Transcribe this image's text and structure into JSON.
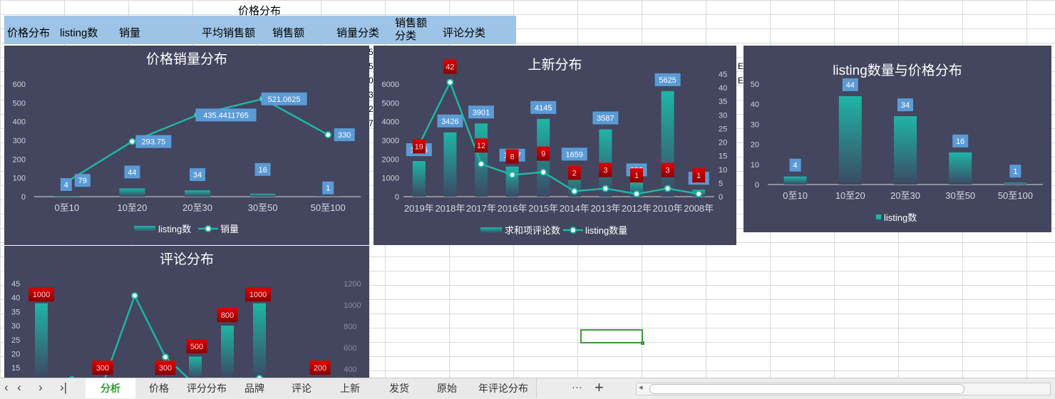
{
  "sheet": {
    "title": "价格分布",
    "headers": [
      "价格分布",
      "listing数",
      "销量",
      "平均销售额",
      "销售额",
      "销量分类",
      "销售额\n分类",
      "评论分类"
    ]
  },
  "charts": {
    "price_sales": {
      "title": "价格销量分布",
      "chart_data": {
        "type": "bar+line",
        "categories": [
          "0至10",
          "10至20",
          "20至30",
          "30至50",
          "50至100"
        ],
        "series": [
          {
            "name": "listing数",
            "type": "bar",
            "values": [
              4,
              44,
              34,
              16,
              1
            ]
          },
          {
            "name": "销量",
            "type": "line",
            "values": [
              79,
              293.75,
              435.4411765,
              521.0625,
              330
            ]
          }
        ],
        "y_ticks": [
          "0",
          "100",
          "200",
          "300",
          "400",
          "500",
          "600"
        ],
        "ylim": [
          0,
          600
        ],
        "bar_scale_max": 600,
        "line_labels": [
          "79",
          "293.75",
          "435.4411765",
          "521.0625",
          "330"
        ],
        "bar_labels": [
          "4",
          "44",
          "34",
          "16",
          "1"
        ]
      }
    },
    "new_listing": {
      "title": "上新分布",
      "chart_data": {
        "type": "bar+line",
        "categories": [
          "2019年",
          "2018年",
          "2017年",
          "2016年",
          "2015年",
          "2014年",
          "2013年",
          "2012年",
          "2010年",
          "2008年"
        ],
        "series": [
          {
            "name": "求和项评论数",
            "type": "bar",
            "values": [
              1895,
              3426,
              3901,
              1607,
              4145,
              1659,
              3587,
              823,
              5625,
              372
            ]
          },
          {
            "name": "listing数量",
            "type": "line",
            "values": [
              19,
              42,
              12,
              8,
              9,
              2,
              3,
              1,
              3,
              1
            ]
          }
        ],
        "y_ticks": [
          "0",
          "1000",
          "2000",
          "3000",
          "4000",
          "5000",
          "6000"
        ],
        "ylim": [
          0,
          6000
        ],
        "y2_ticks": [
          "0",
          "5",
          "10",
          "15",
          "20",
          "25",
          "30",
          "35",
          "40",
          "45"
        ],
        "y2lim": [
          0,
          45
        ],
        "bar_labels": [
          "1895",
          "3426",
          "3901",
          "1607",
          "4145",
          "1659",
          "3587",
          "823",
          "5625",
          "372"
        ],
        "line_labels": [
          "19",
          "42",
          "12",
          "8",
          "9",
          "2",
          "3",
          "1",
          "3",
          "1"
        ]
      }
    },
    "listing_price": {
      "title": "listing数量与价格分布",
      "chart_data": {
        "type": "bar",
        "categories": [
          "0至10",
          "10至20",
          "20至30",
          "30至50",
          "50至100"
        ],
        "series": [
          {
            "name": "listing数",
            "values": [
              4,
              44,
              34,
              16,
              1
            ]
          }
        ],
        "y_ticks": [
          "0",
          "10",
          "20",
          "30",
          "40",
          "50"
        ],
        "ylim": [
          0,
          50
        ],
        "bar_labels": [
          "4",
          "44",
          "34",
          "16",
          "1"
        ]
      }
    },
    "review_dist": {
      "title": "评论分布",
      "chart_data": {
        "type": "bar+line",
        "y_ticks": [
          "15",
          "20",
          "25",
          "30",
          "35",
          "40",
          "45"
        ],
        "y2_ticks": [
          "400",
          "600",
          "800",
          "1000",
          "1200"
        ],
        "series": [
          {
            "name": "",
            "type": "bar",
            "values": [
              38,
              12,
              13,
              19,
              30,
              38,
              12
            ]
          },
          {
            "name": "",
            "type": "line",
            "values": [
              300,
              350,
              1100,
              500,
              300,
              350,
              300
            ]
          }
        ],
        "red_labels": [
          "1000",
          "300",
          "300",
          "500",
          "800",
          "1000",
          "200"
        ]
      }
    }
  },
  "fragments": [
    "5",
    "5",
    "0",
    "3",
    "2",
    "7",
    "E",
    "E"
  ],
  "tabs": {
    "nav": [
      "‹",
      "‹",
      "›",
      "›|"
    ],
    "items": [
      "分析",
      "价格",
      "评分分布",
      "品牌",
      "评论",
      "上新",
      "发货",
      "原始",
      "年评论分布"
    ],
    "more": "···",
    "add": "+"
  },
  "colors": {
    "chart_bg": "#43465e",
    "teal": "#1fb5a6",
    "label_blue": "#5b9bd5",
    "label_red": "#c00000"
  }
}
